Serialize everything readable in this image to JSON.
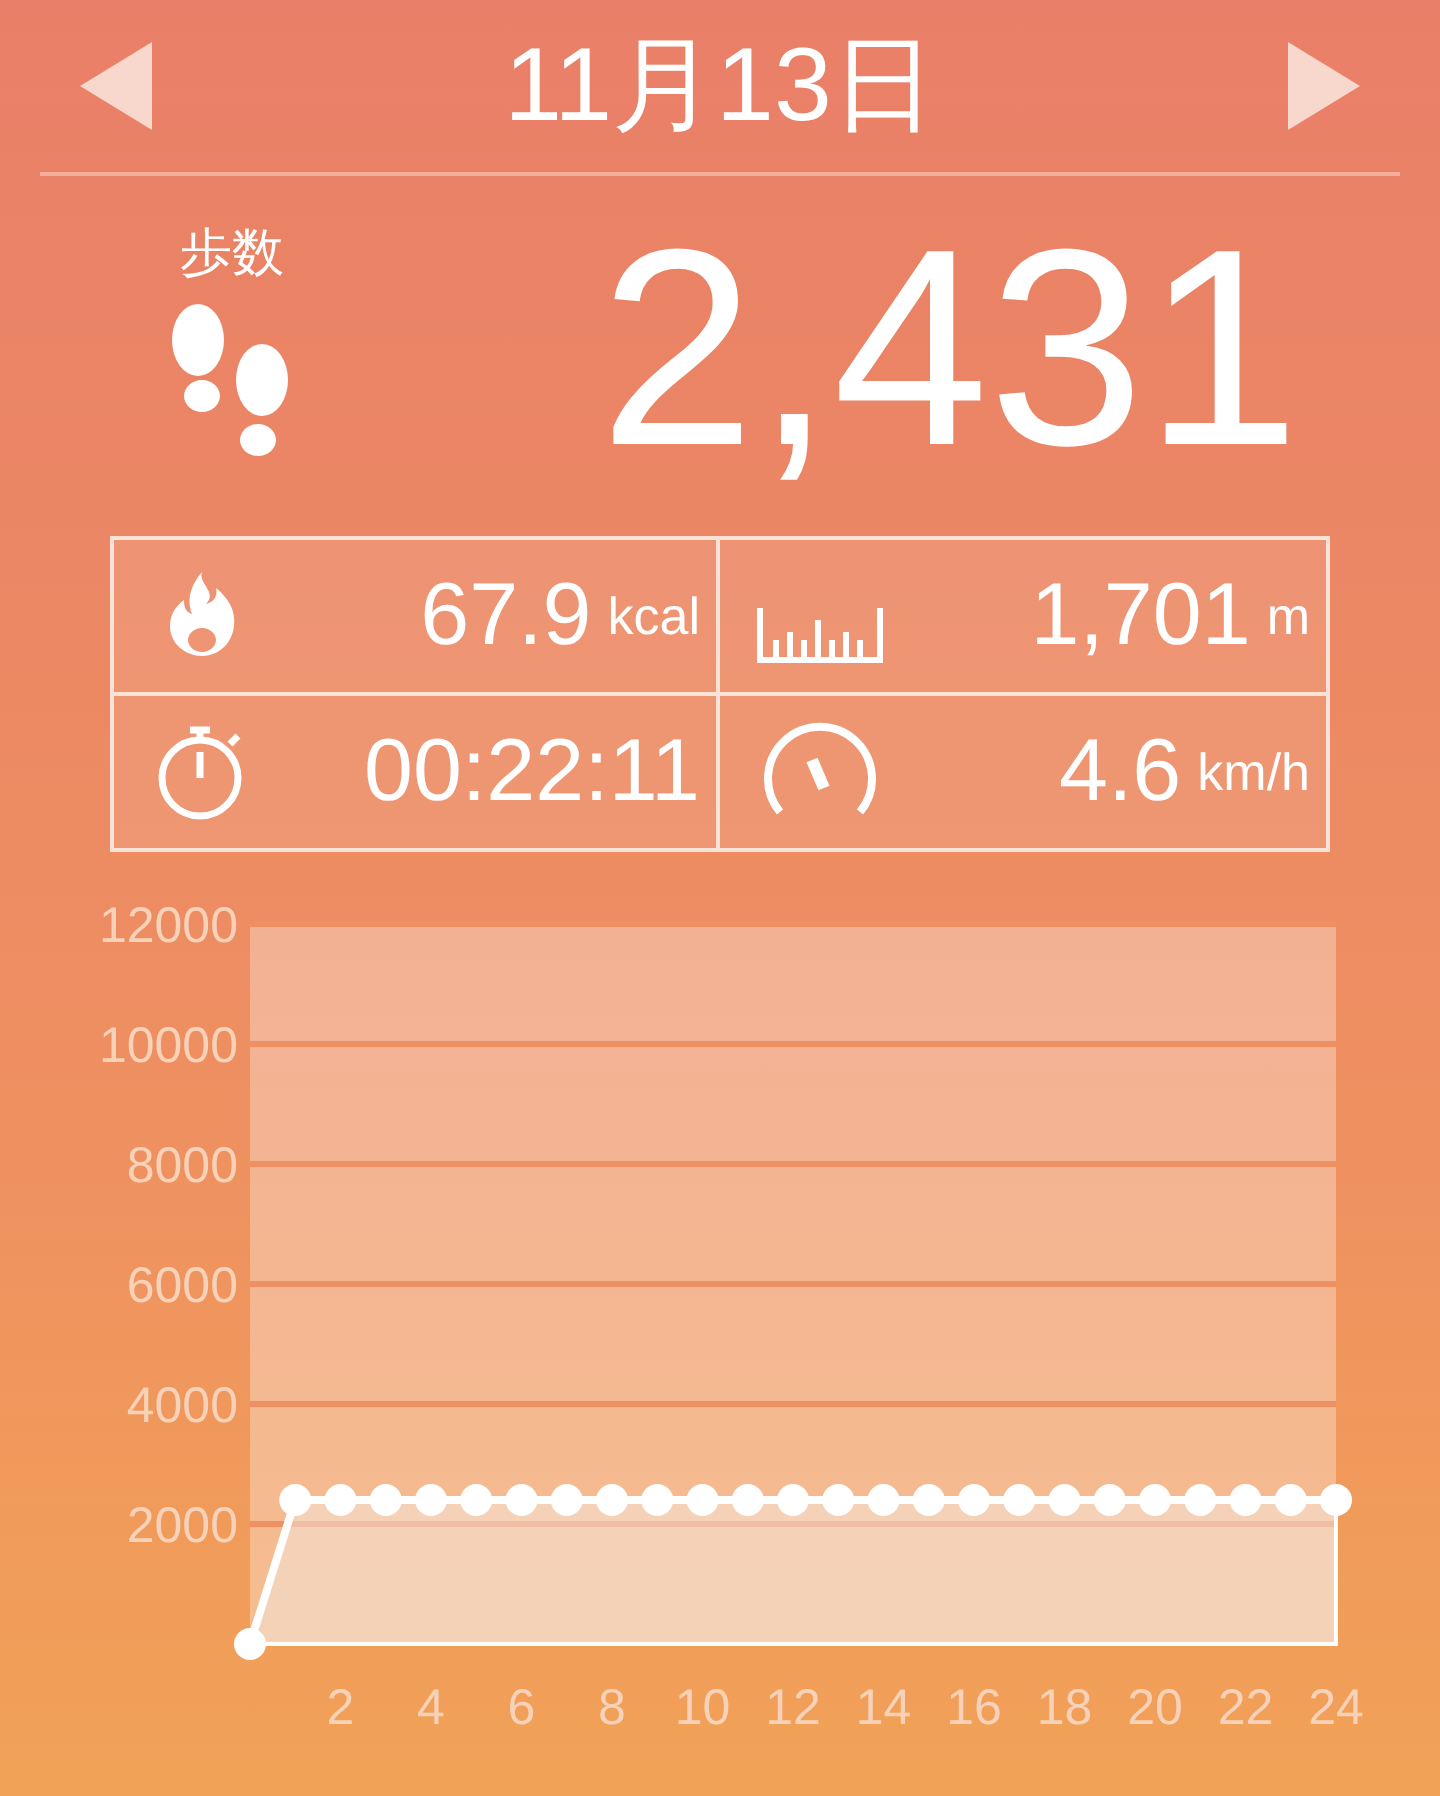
{
  "header": {
    "date": "11月13日"
  },
  "steps": {
    "label": "歩数",
    "value": "2,431"
  },
  "stats": [
    {
      "kind": "calories",
      "value": "67.9",
      "unit": "kcal"
    },
    {
      "kind": "distance",
      "value": "1,701",
      "unit": "m"
    },
    {
      "kind": "time",
      "value": "00:22:11"
    },
    {
      "kind": "speed",
      "value": "4.6",
      "unit": "km/h"
    }
  ],
  "chart": {
    "chart_data": {
      "type": "area",
      "x": [
        0,
        1,
        2,
        3,
        4,
        5,
        6,
        7,
        8,
        9,
        10,
        11,
        12,
        13,
        14,
        15,
        16,
        17,
        18,
        19,
        20,
        21,
        22,
        23,
        24
      ],
      "series": [
        {
          "color": "#ffffff",
          "values": [
            0,
            2400,
            2400,
            2400,
            2400,
            2400,
            2400,
            2400,
            2400,
            2400,
            2400,
            2400,
            2400,
            2400,
            2400,
            2400,
            2400,
            2400,
            2400,
            2400,
            2400,
            2400,
            2400,
            2400,
            2400
          ]
        }
      ],
      "grid": true,
      "xlim": [
        0,
        24
      ],
      "ylim": [
        0,
        12000
      ],
      "xticks": [
        2,
        4,
        6,
        8,
        10,
        12,
        14,
        16,
        18,
        20,
        22,
        24
      ],
      "yticks": [
        2000,
        4000,
        6000,
        8000,
        10000,
        12000
      ]
    }
  }
}
